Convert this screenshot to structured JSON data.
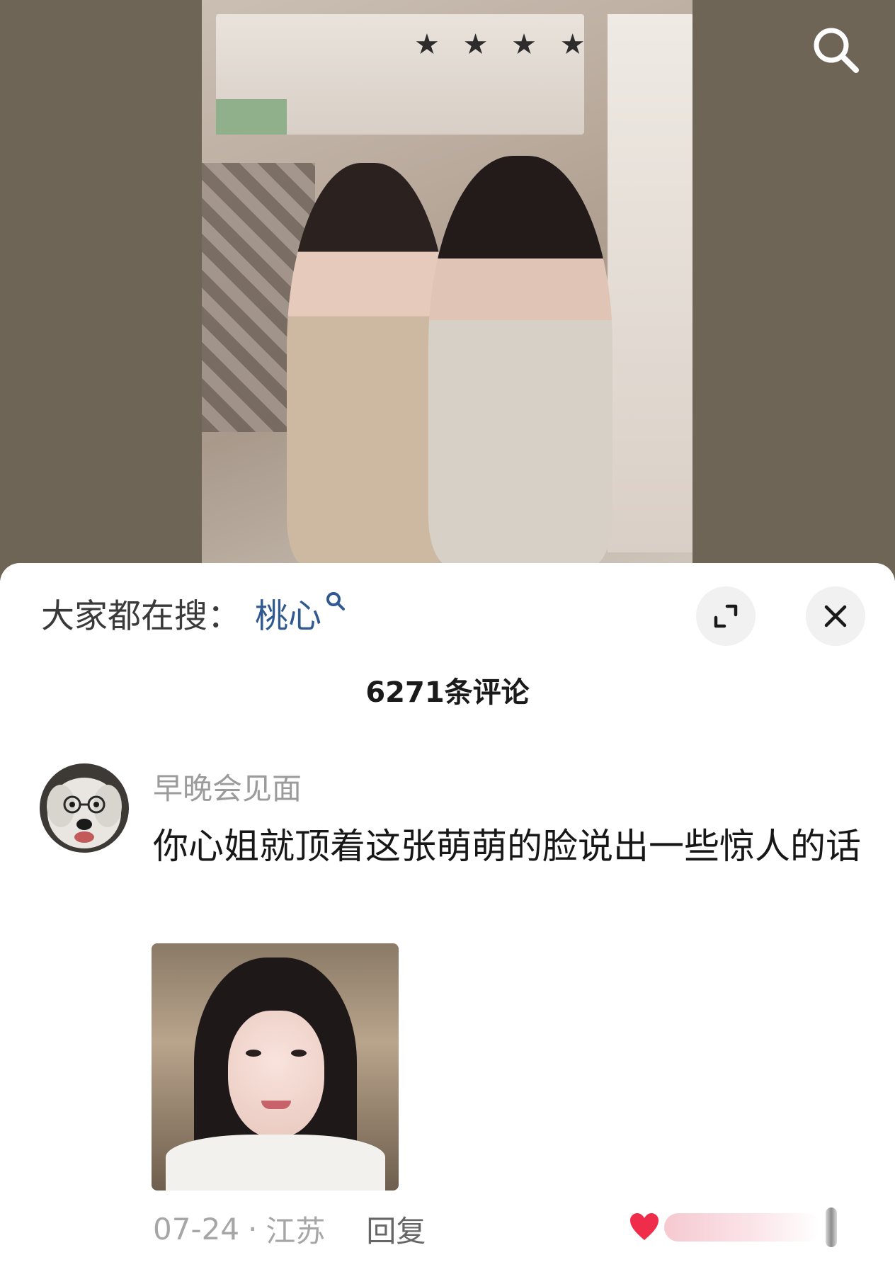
{
  "video": {
    "search_icon": "search-icon"
  },
  "sheet": {
    "trending_label": "大家都在搜：",
    "trending_topic": "桃心",
    "expand_icon": "expand-icon",
    "close_icon": "close-icon",
    "comment_count": "6271条评论"
  },
  "comments": [
    {
      "username": "早晚会见面",
      "text": "你心姐就顶着这张萌萌的脸说出一些惊人的话",
      "date": "07-24",
      "separator": "·",
      "location": "江苏",
      "reply_label": "回复"
    }
  ],
  "colors": {
    "topic_link": "#305891",
    "like": "#ef2d4a"
  }
}
